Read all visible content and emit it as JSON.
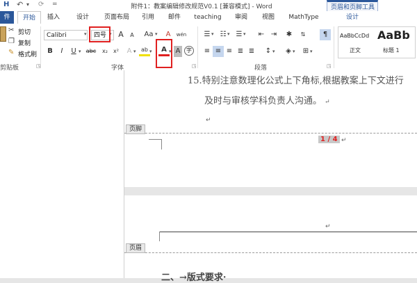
{
  "window": {
    "title": "附件1：教案编辑修改规范V0.1 [兼容模式] - Word",
    "quick_access": {
      "save": "H",
      "undo": "↶",
      "undo_drop": "▾",
      "redo": "⟳",
      "customize": "="
    }
  },
  "tabs": {
    "file": "件",
    "home": "开始",
    "insert": "插入",
    "design": "设计",
    "layout": "页面布局",
    "references": "引用",
    "mailings": "邮件",
    "teaching": "teaching",
    "review": "审阅",
    "view": "视图",
    "mathtype": "MathType",
    "context_group": "页眉和页脚工具",
    "context_design": "设计"
  },
  "clipboard": {
    "cut": "剪切",
    "copy": "复制",
    "format_painter": "格式刷",
    "group_label": "剪贴板"
  },
  "font": {
    "font_name": "Calibri",
    "font_size": "四号",
    "grow": "A",
    "shrink": "A",
    "change_case": "Aa",
    "clear_format": "A",
    "phonetic": "wén",
    "bold": "B",
    "italic": "I",
    "underline": "U",
    "strikethrough": "abc",
    "subscript": "x₂",
    "superscript": "x²",
    "text_effect": "A",
    "highlight": "ab",
    "font_color": "A",
    "char_shading": "A",
    "enclose": "字",
    "group_label": "字体"
  },
  "paragraph": {
    "group_label": "段落"
  },
  "styles": {
    "normal_preview": "AaBbCcDd",
    "normal_label": "正文",
    "heading1_preview": "AaBb",
    "heading1_label": "标题 1"
  },
  "document": {
    "line1": "15.特别注意数理化公式上下角标,根据教案上下文进行",
    "line2": "及时与审核学科负责人沟通。",
    "para_mark": "↵",
    "footer_tag": "页脚",
    "page_number": "1 / 4",
    "header_tag": "页眉",
    "next_heading": "二、→版式要求·"
  },
  "colors": {
    "accent": "#2b579a",
    "highlight_box": "#e02020",
    "font_color_underline": "#e02020",
    "page_number_bg": "#c8c8c8"
  }
}
